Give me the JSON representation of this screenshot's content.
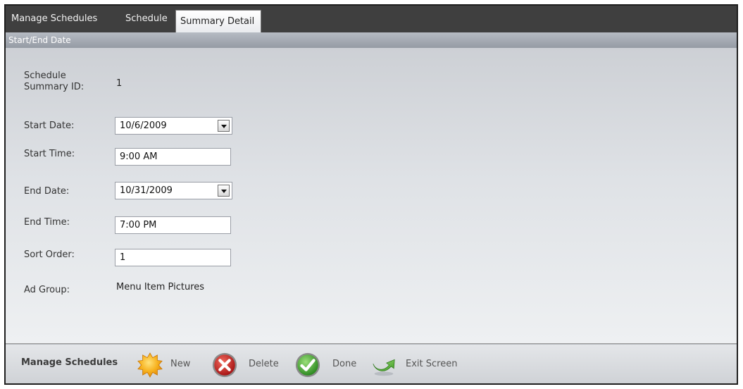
{
  "tabs": [
    {
      "label": "Manage Schedules"
    },
    {
      "label": "Schedule"
    },
    {
      "label": "Summary Detail",
      "active": true
    }
  ],
  "section_title": "Start/End Date",
  "form": {
    "summary_id_label_line1": "Schedule",
    "summary_id_label_line2": "Summary ID:",
    "summary_id_value": "1",
    "start_date_label": "Start Date:",
    "start_date_value": "10/6/2009",
    "start_time_label": "Start Time:",
    "start_time_value": "9:00 AM",
    "end_date_label": "End Date:",
    "end_date_value": "10/31/2009",
    "end_time_label": "End Time:",
    "end_time_value": "7:00 PM",
    "sort_order_label": "Sort Order:",
    "sort_order_value": "1",
    "ad_group_label": "Ad Group:",
    "ad_group_value": "Menu Item Pictures"
  },
  "toolbar": {
    "title": "Manage Schedules",
    "new_label": "New",
    "delete_label": "Delete",
    "done_label": "Done",
    "exit_label": "Exit Screen"
  },
  "icons": {
    "new": "sunburst-icon",
    "delete": "red-x-circle-icon",
    "done": "green-check-circle-icon",
    "exit": "green-curved-arrow-icon"
  },
  "colors": {
    "tab_bar": "#3f3f3f",
    "section_header": "#a3a8b0",
    "new_icon": "#f5a71b",
    "delete_icon": "#c62828",
    "done_icon": "#3a9a2e",
    "exit_icon": "#5fb83a"
  }
}
